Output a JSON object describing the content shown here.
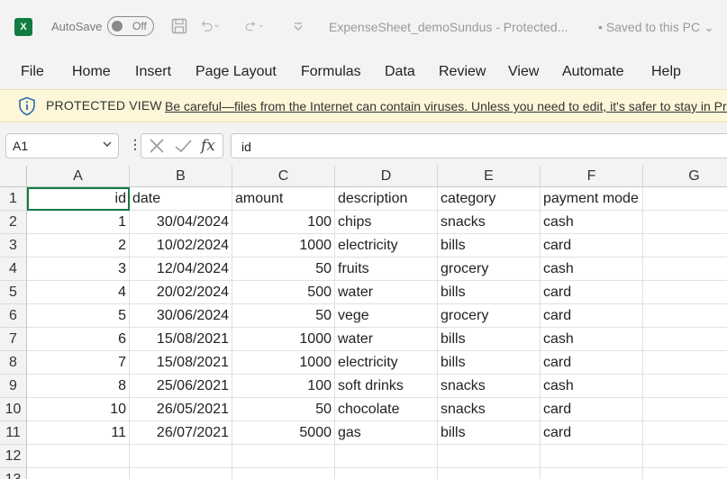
{
  "titlebar": {
    "logo_letter": "X",
    "autosave_label": "AutoSave",
    "autosave_state": "Off",
    "doc_title": "ExpenseSheet_demoSundus  -  Protected...",
    "saved_status": "• Saved to this PC ⌄",
    "icons": [
      "save-icon",
      "undo-icon",
      "redo-icon",
      "customize-quick-access-icon"
    ]
  },
  "menu": [
    "File",
    "Home",
    "Insert",
    "Page Layout",
    "Formulas",
    "Data",
    "Review",
    "View",
    "Automate",
    "Help"
  ],
  "protected_view": {
    "title": "PROTECTED VIEW",
    "message": "Be careful—files from the Internet can contain viruses. Unless you need to edit, it's safer to stay in Protected View."
  },
  "formula_bar": {
    "name_box": "A1",
    "fx_label": "fx",
    "formula": "id"
  },
  "sheet": {
    "columns": [
      "A",
      "B",
      "C",
      "D",
      "E",
      "F",
      "G"
    ],
    "row_numbers": [
      "1",
      "2",
      "3",
      "4",
      "5",
      "6",
      "7",
      "8",
      "9",
      "10",
      "11",
      "12",
      "13"
    ],
    "selected_cell": "A1",
    "rows": [
      [
        "id",
        "date",
        "amount",
        "description",
        "category",
        "payment mode",
        ""
      ],
      [
        "1",
        "30/04/2024",
        "100",
        "chips",
        "snacks",
        "cash",
        ""
      ],
      [
        "2",
        "10/02/2024",
        "1000",
        "electricity",
        "bills",
        "card",
        ""
      ],
      [
        "3",
        "12/04/2024",
        "50",
        "fruits",
        "grocery",
        "cash",
        ""
      ],
      [
        "4",
        "20/02/2024",
        "500",
        "water",
        "bills",
        "card",
        ""
      ],
      [
        "5",
        "30/06/2024",
        "50",
        "vege",
        "grocery",
        "card",
        ""
      ],
      [
        "6",
        "15/08/2021",
        "1000",
        "water",
        "bills",
        "cash",
        ""
      ],
      [
        "7",
        "15/08/2021",
        "1000",
        "electricity",
        "bills",
        "card",
        ""
      ],
      [
        "8",
        "25/06/2021",
        "100",
        "soft drinks",
        "snacks",
        "cash",
        ""
      ],
      [
        "10",
        "26/05/2021",
        "50",
        "chocolate",
        "snacks",
        "card",
        ""
      ],
      [
        "11",
        "26/07/2021",
        "5000",
        "gas",
        "bills",
        "card",
        ""
      ],
      [
        "",
        "",
        "",
        "",
        "",
        "",
        ""
      ],
      [
        "",
        "",
        "",
        "",
        "",
        "",
        ""
      ]
    ]
  },
  "colors": {
    "accent": "#107c41",
    "warning_bar": "#fdf6d8"
  }
}
